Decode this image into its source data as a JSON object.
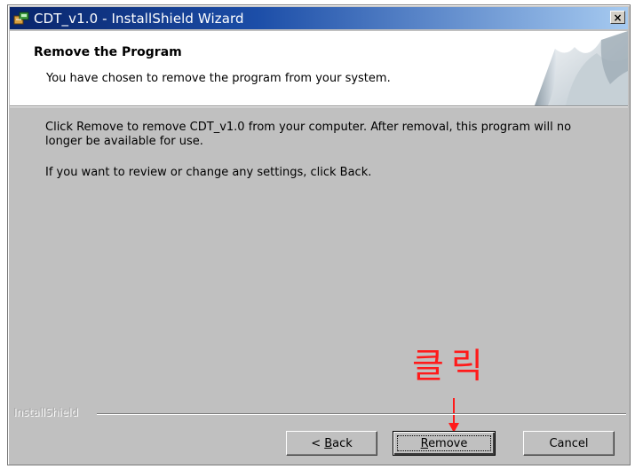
{
  "window": {
    "title": "CDT_v1.0 - InstallShield Wizard",
    "close_label": "×"
  },
  "header": {
    "title": "Remove the Program",
    "subtitle": "You have chosen to remove the program from your system."
  },
  "body": {
    "paragraph1": "Click Remove to remove CDT_v1.0 from your computer. After removal, this program will no longer be available for use.",
    "paragraph2": "If you want to review or change any settings, click Back."
  },
  "annotation": {
    "text": "클릭",
    "color": "#ff1a1a"
  },
  "footer": {
    "brand": "InstallShield"
  },
  "buttons": {
    "back_prefix": "< ",
    "back_mnemonic": "B",
    "back_rest": "ack",
    "remove_mnemonic": "R",
    "remove_rest": "emove",
    "cancel_label": "Cancel"
  },
  "colors": {
    "titlebar_start": "#08246b",
    "titlebar_end": "#a6caf0",
    "dialog_background": "#c0c0c0",
    "header_background": "#ffffff"
  },
  "icons": {
    "app": "installer-icon",
    "close": "close-icon",
    "header": "page-curl-graphic",
    "annotation": "down-arrow-icon"
  }
}
